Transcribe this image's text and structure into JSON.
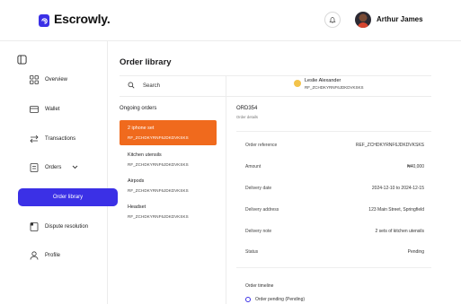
{
  "header": {
    "brand": "Escrowly.",
    "user_name": "Arthur James"
  },
  "colors": {
    "accent": "#3b30e6",
    "active_order": "#f06a1d"
  },
  "sidebar": {
    "items": [
      {
        "label": "Overview",
        "icon": "grid-icon"
      },
      {
        "label": "Wallet",
        "icon": "wallet-icon"
      },
      {
        "label": "Transactions",
        "icon": "transfer-icon"
      },
      {
        "label": "Orders",
        "icon": "orders-icon"
      },
      {
        "label": "Order library",
        "icon": ""
      },
      {
        "label": "Dispute resolution",
        "icon": "dispute-icon"
      },
      {
        "label": "Profile",
        "icon": "user-icon"
      }
    ]
  },
  "main": {
    "title": "Order library",
    "search_placeholder": "Search",
    "ongoing_label": "Ongoing orders",
    "orders": [
      {
        "name": "2 iphone set",
        "ref": "RF_ZCHDKYRNF6JDKDVKSKS"
      },
      {
        "name": "Kitchen utensils",
        "ref": "RF_ZCHDKYRNF6JDKDVKSKS"
      },
      {
        "name": "Airpods",
        "ref": "RF_ZCHDKYRNF6JDKDVKSKS"
      },
      {
        "name": "Headset",
        "ref": "RF_ZCHDKYRNF6JDKDVKSKS"
      }
    ]
  },
  "detail": {
    "merchant_name": "Leslie Alexander",
    "merchant_ref": "RF_ZCHDKYRNF6JDKDVKSKS",
    "order_id": "ORD354",
    "order_subtitle": "Order details",
    "rows": [
      {
        "key": "Order reference",
        "value": "REF_ZCHDKYRNF6JDKDVKSKS"
      },
      {
        "key": "Amount",
        "value": "₦40,000"
      },
      {
        "key": "Delivery date",
        "value": "2024-12-10 to 2024-12-15"
      },
      {
        "key": "Delivery address",
        "value": "123 Main Street, Springfield"
      },
      {
        "key": "Delivery note",
        "value": "2 sets of kitchen utensils"
      },
      {
        "key": "Status",
        "value": "Pending"
      }
    ],
    "timeline_title": "Order timeline",
    "timeline_first": "Order pending (Pending)"
  }
}
